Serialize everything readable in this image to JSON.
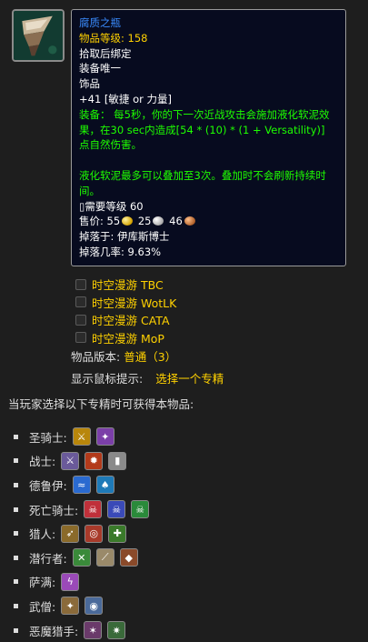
{
  "item": {
    "icon": "putrid-vial-icon",
    "name": "腐质之瓶",
    "item_level": "物品等级: 158",
    "binding": "拾取后绑定",
    "unique": "装备唯一",
    "slot": "饰品",
    "stat": "+41 [敏捷 or 力量]",
    "equip_lines": [
      "装备： 每5秒，你的下一次近战攻击会施加液化软泥效",
      "果，在30 sec内造成[54 * (10) * (1 + Versatility)]",
      "点自然伤害。"
    ],
    "stack_lines": [
      "液化软泥最多可以叠加至3次。叠加时不会刷新持续时",
      "间。"
    ],
    "required_level": "▯需要等级 60",
    "sell_label": "售价:",
    "sell_gold": "55",
    "sell_silver": "25",
    "sell_copper": "46",
    "dropped_by": "掉落于: 伊库斯博士",
    "drop_rate": "掉落几率: 9.63%"
  },
  "checkboxes": [
    {
      "label": "时空漫游 TBC",
      "checked": false
    },
    {
      "label": "时空漫游 WotLK",
      "checked": false
    },
    {
      "label": "时空漫游 CATA",
      "checked": false
    },
    {
      "label": "时空漫游 MoP",
      "checked": false
    }
  ],
  "version": {
    "label": "物品版本:",
    "value": "普通（3）"
  },
  "mouseover": {
    "label": "显示鼠标提示:",
    "link": "选择一个专精"
  },
  "obtain_title": "当玩家选择以下专精时可获得本物品:",
  "classes": [
    {
      "name": "圣骑士:",
      "specs": [
        {
          "icon": "paladin-retribution-icon",
          "color": "#b8860b"
        },
        {
          "icon": "paladin-protection-icon",
          "color": "#7b3fa8"
        }
      ]
    },
    {
      "name": "战士:",
      "specs": [
        {
          "icon": "warrior-arms-icon",
          "color": "#6a5a9a"
        },
        {
          "icon": "warrior-fury-icon",
          "color": "#b33a1a"
        },
        {
          "icon": "warrior-protection-icon",
          "color": "#8a8a8a"
        }
      ]
    },
    {
      "name": "德鲁伊:",
      "specs": [
        {
          "icon": "druid-feral-icon",
          "color": "#2a6ad0"
        },
        {
          "icon": "druid-guardian-icon",
          "color": "#1e7ab8"
        }
      ]
    },
    {
      "name": "死亡骑士:",
      "specs": [
        {
          "icon": "deathknight-blood-icon",
          "color": "#c0303a"
        },
        {
          "icon": "deathknight-frost-icon",
          "color": "#3a4ab8"
        },
        {
          "icon": "deathknight-unholy-icon",
          "color": "#2a8a3a"
        }
      ]
    },
    {
      "name": "猎人:",
      "specs": [
        {
          "icon": "hunter-beastmastery-icon",
          "color": "#8a6a2a"
        },
        {
          "icon": "hunter-marksmanship-icon",
          "color": "#a83a2a"
        },
        {
          "icon": "hunter-survival-icon",
          "color": "#3a7a2a"
        }
      ]
    },
    {
      "name": "潜行者:",
      "specs": [
        {
          "icon": "rogue-assassination-icon",
          "color": "#3a8a3a"
        },
        {
          "icon": "rogue-outlaw-icon",
          "color": "#9a8a6a"
        },
        {
          "icon": "rogue-subtlety-icon",
          "color": "#8a4a2a"
        }
      ]
    },
    {
      "name": "萨满:",
      "specs": [
        {
          "icon": "shaman-enhancement-icon",
          "color": "#9a4ab8"
        }
      ]
    },
    {
      "name": "武僧:",
      "specs": [
        {
          "icon": "monk-windwalker-icon",
          "color": "#8a6a3a"
        },
        {
          "icon": "monk-brewmaster-icon",
          "color": "#4a6a9a"
        }
      ]
    },
    {
      "name": "恶魔猎手:",
      "specs": [
        {
          "icon": "demonhunter-havoc-icon",
          "color": "#6a3a6a"
        },
        {
          "icon": "demonhunter-vengeance-icon",
          "color": "#3a6a3a"
        }
      ]
    }
  ]
}
